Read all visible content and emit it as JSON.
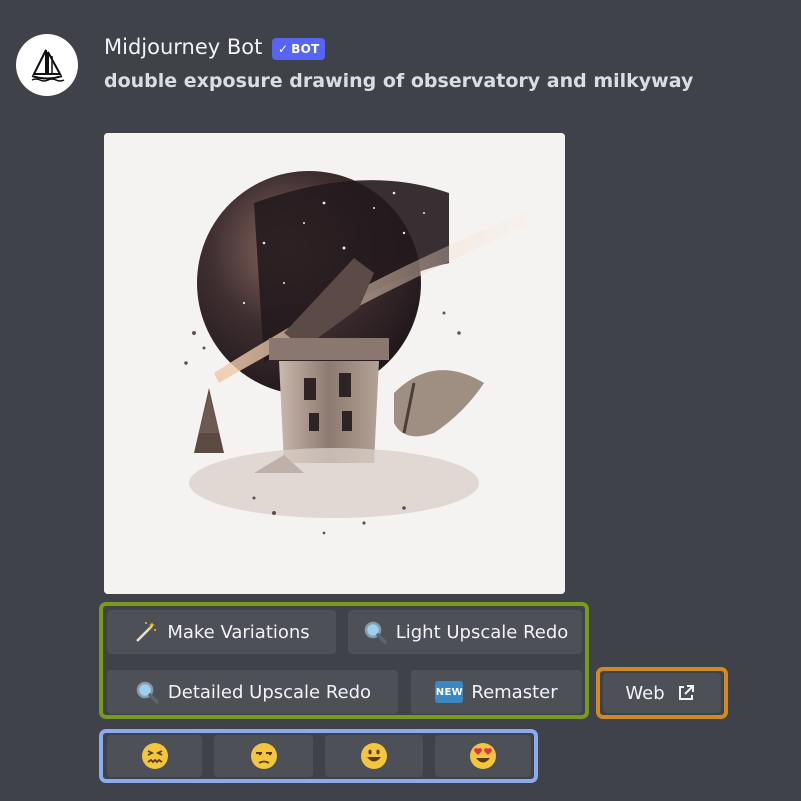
{
  "message": {
    "author": "Midjourney Bot",
    "badge": "BOT",
    "prompt": "double exposure drawing of observatory and milkyway"
  },
  "image": {
    "subject": "observatory-milkyway-double-exposure"
  },
  "buttons": {
    "make_variations": "Make Variations",
    "light_upscale_redo": "Light Upscale Redo",
    "detailed_upscale_redo": "Detailed Upscale Redo",
    "remaster": "Remaster",
    "new_badge": "NEW",
    "web": "Web"
  },
  "reactions": [
    {
      "icon": "confounded-face-icon"
    },
    {
      "icon": "unamused-face-icon"
    },
    {
      "icon": "smiling-face-icon"
    },
    {
      "icon": "heart-eyes-face-icon"
    }
  ],
  "colors": {
    "background": "#404249",
    "button": "#4e5058",
    "highlight_green": "#7a9a1e",
    "highlight_orange": "#d4891e",
    "highlight_blue": "#8aabee",
    "badge": "#5865f2"
  }
}
